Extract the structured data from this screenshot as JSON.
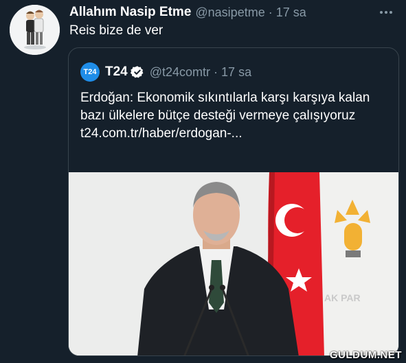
{
  "tweet": {
    "display_name": "Allahım Nasip Etme",
    "handle": "@nasipetme",
    "separator": "·",
    "time": "17 sa",
    "text": "Reis bize de ver",
    "avatar_icon": "avatar-cartoon-icon",
    "more_icon": "more-dots-icon"
  },
  "quote": {
    "logo_text": "T24",
    "display_name": "T24",
    "verified_icon": "verified-badge-icon",
    "handle": "@t24comtr",
    "separator": "·",
    "time": "17 sa",
    "text": "Erdoğan: Ekonomik sıkıntılarla karşı karşıya kalan bazı ülkelere bütçe desteği vermeye çalışıyoruz",
    "link": "t24.com.tr/haber/erdogan-..."
  },
  "watermark": "GULDUM.NET",
  "colors": {
    "background": "#15202b",
    "border": "#38444d",
    "secondary_text": "#8899a6",
    "t24_blue": "#1f8de8"
  }
}
